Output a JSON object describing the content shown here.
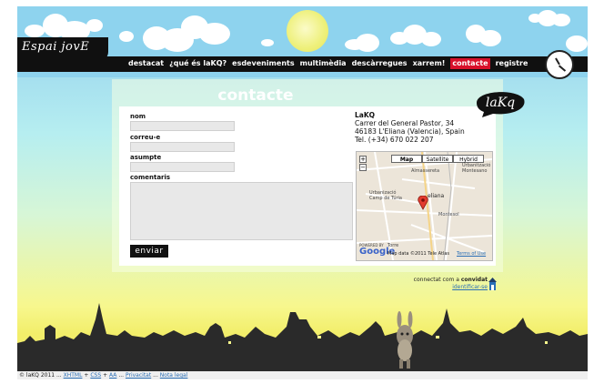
{
  "site": {
    "logo": "Espai jovE",
    "badge": "laKq"
  },
  "nav": {
    "items": [
      "destacat",
      "¿qué és laKQ?",
      "esdeveniments",
      "multimèdia",
      "descàrregues",
      "xarrem!",
      "contacte",
      "registre"
    ],
    "active_index": 6
  },
  "page": {
    "title": "contacte"
  },
  "form": {
    "name_label": "nom",
    "email_label": "correu-e",
    "subject_label": "asumpte",
    "comments_label": "comentaris",
    "submit_label": "enviar"
  },
  "address": {
    "name": "LaKQ",
    "street": "Carrer del General Pastor, 34",
    "city": "46183 L'Eliana (Valencia), Spain",
    "phone": "Tel. (+34) 670 022 207"
  },
  "map": {
    "types": [
      "Map",
      "Satellite",
      "Hybrid"
    ],
    "active_type": "Map",
    "zoom_in": "+",
    "zoom_out": "−",
    "labels": [
      "Urbanizació Camp de Túria",
      "Almassereta",
      "Urbanització Montesano",
      "Montesol",
      "Torre",
      "eliana"
    ],
    "powered_by": "POWERED BY",
    "brand": "Google",
    "attribution": "Map data ©2011 Tele Atlas",
    "terms": "Terms of Use"
  },
  "session": {
    "prefix": "connectat com a",
    "user": "convidat",
    "login_link": "identificar-se"
  },
  "footer": {
    "copyright": "© laKQ 2011 ...",
    "links": [
      "XHTML",
      "CSS",
      "AA",
      "Privacitat",
      "Nota legal"
    ],
    "sep1": "+",
    "sep2": "+",
    "sep3": "...",
    "sep4": "..."
  },
  "colors": {
    "sky": "#8ed3ee",
    "nav_bg": "#101010",
    "active": "#d8102a",
    "sunset": "#f2ee6a",
    "silhouette": "#2a2a2a"
  }
}
